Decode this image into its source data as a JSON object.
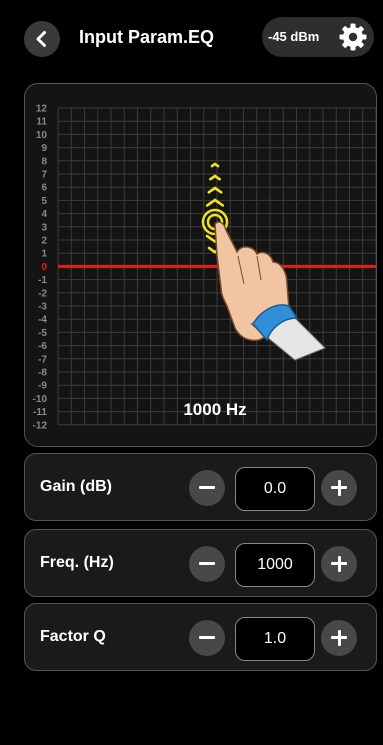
{
  "header": {
    "title": "Input Param.EQ",
    "level": "-45 dBm"
  },
  "graph": {
    "y_ticks": [
      "12",
      "11",
      "10",
      "9",
      "8",
      "7",
      "6",
      "5",
      "4",
      "3",
      "2",
      "1",
      "0",
      "-1",
      "-2",
      "-3",
      "-4",
      "-5",
      "-6",
      "-7",
      "-8",
      "-9",
      "-10",
      "-11",
      "-12"
    ],
    "current_gain_db": 0,
    "frequency_label": "1000 Hz"
  },
  "controls": [
    {
      "label": "Gain (dB)",
      "value": "0.0"
    },
    {
      "label": "Freq. (Hz)",
      "value": "1000"
    },
    {
      "label": "Factor Q",
      "value": "1.0"
    }
  ],
  "colors": {
    "eq_line": "#e0201b",
    "gesture_arrows": "#f2e31a",
    "zero_tick": "#e0201b"
  }
}
